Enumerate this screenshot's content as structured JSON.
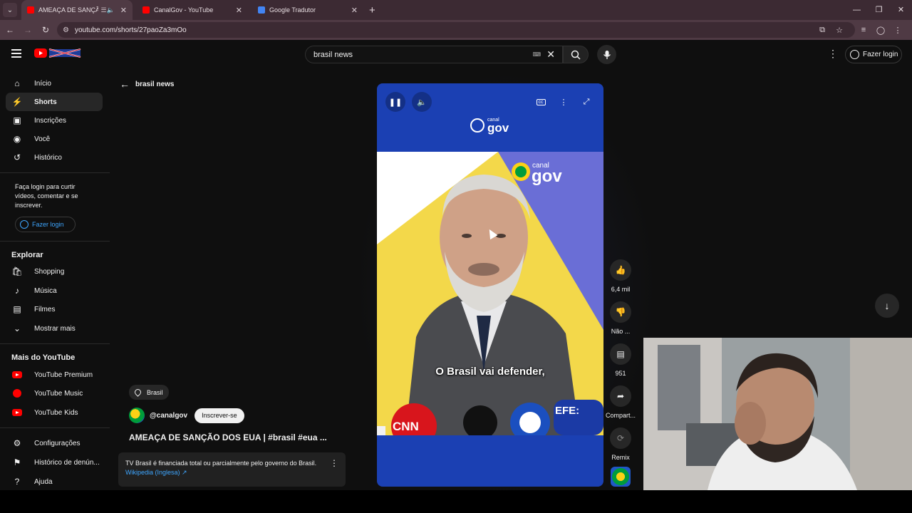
{
  "browser": {
    "tabs": [
      {
        "title": "AMEAÇA DE SANÇÃO DOS",
        "active": true,
        "favicon": "youtube-icon",
        "aux": "☰🔈"
      },
      {
        "title": "CanalGov - YouTube",
        "active": false,
        "favicon": "youtube-icon"
      },
      {
        "title": "Google Tradutor",
        "active": false,
        "favicon": "translate-icon"
      }
    ],
    "url": "youtube.com/shorts/27paoZa3mOo"
  },
  "header": {
    "search_value": "brasil news",
    "login_label": "Fazer login"
  },
  "sidebar": {
    "items": [
      {
        "label": "Início",
        "icon": "home-icon"
      },
      {
        "label": "Shorts",
        "icon": "shorts-icon",
        "active": true
      },
      {
        "label": "Inscrições",
        "icon": "subscriptions-icon"
      },
      {
        "label": "Você",
        "icon": "profile-icon"
      },
      {
        "label": "Histórico",
        "icon": "history-icon"
      }
    ],
    "login_note": "Faça login para curtir vídeos, comentar e se inscrever.",
    "login_button": "Fazer login",
    "explore_title": "Explorar",
    "explore": [
      {
        "label": "Shopping",
        "icon": "shopping-icon"
      },
      {
        "label": "Música",
        "icon": "music-icon"
      },
      {
        "label": "Filmes",
        "icon": "movies-icon"
      },
      {
        "label": "Mostrar mais",
        "icon": "chevron-down-icon"
      }
    ],
    "more_title": "Mais do YouTube",
    "more": [
      {
        "label": "YouTube Premium"
      },
      {
        "label": "YouTube Music"
      },
      {
        "label": "YouTube Kids"
      }
    ],
    "footer": [
      {
        "label": "Configurações",
        "icon": "gear-icon"
      },
      {
        "label": "Histórico de denún...",
        "icon": "flag-icon"
      },
      {
        "label": "Ajuda",
        "icon": "help-icon"
      }
    ]
  },
  "back_label": "brasil news",
  "video": {
    "location": "Brasil",
    "channel": "@canalgov",
    "subscribe": "Inscrever-se",
    "title": "AMEAÇA DE SANÇÃO DOS EUA | #brasil #eua ...",
    "notice_text": "TV Brasil é financiada total ou parcialmente pelo governo do Brasil.",
    "notice_link": "Wikipedia (Inglesa)",
    "subtitle": "O Brasil vai defender,",
    "logo_small": "canal",
    "logo_big": "gov",
    "mics": [
      "CNN",
      "EFE:"
    ]
  },
  "actions": {
    "likes": "6,4 mil",
    "dislike": "Não ...",
    "comments": "951",
    "share": "Compart...",
    "remix": "Remix"
  },
  "colors": {
    "accent": "#ff0000",
    "link": "#3ea6ff",
    "player_blue": "#1b40b3",
    "tab_bar": "#3c2a33"
  }
}
